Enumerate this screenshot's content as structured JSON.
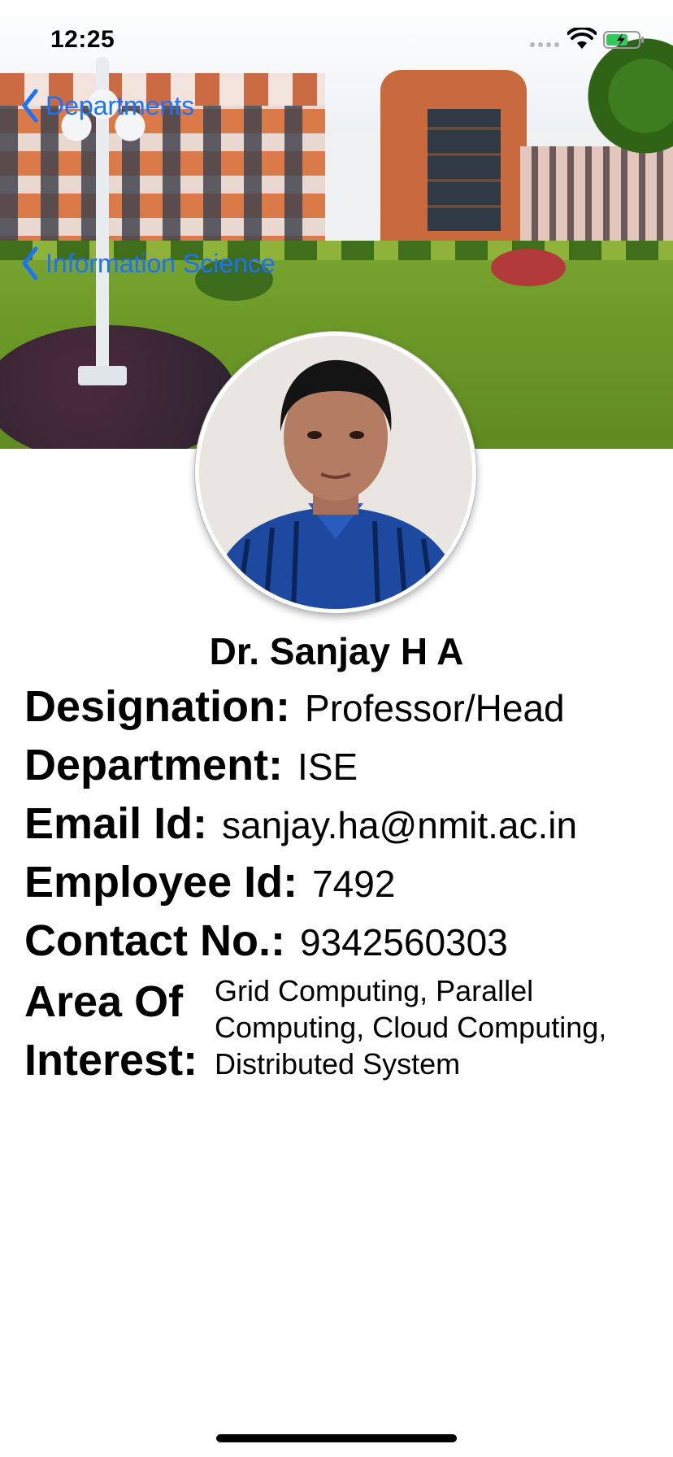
{
  "status_bar": {
    "time": "12:25",
    "battery_color": "#34c759"
  },
  "navigation": {
    "back_primary": "Departments",
    "back_secondary": "Information Science",
    "tint_color": "#1a73ff"
  },
  "profile": {
    "name": "Dr. Sanjay H A",
    "designation_label": "Designation:",
    "designation": "Professor/Head",
    "department_label": "Department:",
    "department": "ISE",
    "email_label": "Email Id:",
    "email": "sanjay.ha@nmit.ac.in",
    "employee_label": "Employee Id:",
    "employee_id": "7492",
    "contact_label": "Contact No.:",
    "contact": "9342560303",
    "interest_label_line1": "Area Of",
    "interest_label_line2": "Interest:",
    "interest": "Grid Computing, Parallel Computing, Cloud Computing, Distributed System"
  },
  "icons": {
    "back": "chevron-left-icon",
    "wifi": "wifi-icon",
    "battery": "battery-charging-icon",
    "signal": "cellular-signal-icon"
  }
}
